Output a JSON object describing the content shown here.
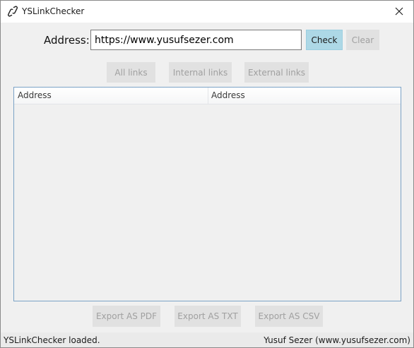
{
  "window": {
    "title": "YSLinkChecker",
    "icon": "link-icon",
    "close_icon": "close-icon"
  },
  "form": {
    "address_label": "Address:",
    "address_value": "https://www.yusufsezer.com",
    "check_label": "Check",
    "clear_label": "Clear"
  },
  "filters": {
    "all_label": "All links",
    "internal_label": "Internal links",
    "external_label": "External links"
  },
  "table": {
    "columns": [
      "Address",
      "Address"
    ],
    "rows": []
  },
  "export": {
    "pdf_label": "Export AS PDF",
    "txt_label": "Export AS TXT",
    "csv_label": "Export AS CSV"
  },
  "status": {
    "left": "YSLinkChecker loaded.",
    "right": "Yusuf Sezer (www.yusufsezer.com)"
  },
  "colors": {
    "accent": "#add8e6",
    "list_border": "#7ba2c6"
  }
}
